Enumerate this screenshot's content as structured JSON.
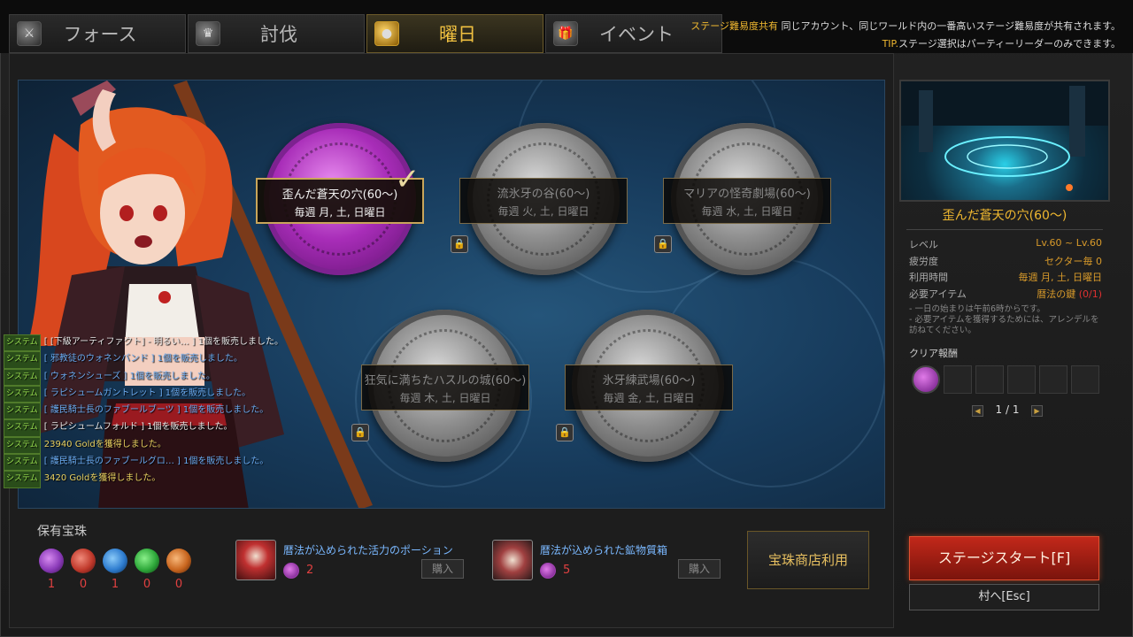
{
  "tabs": [
    {
      "label": "フォース",
      "icon": "force-icon"
    },
    {
      "label": "討伐",
      "icon": "subjugation-icon"
    },
    {
      "label": "曜日",
      "icon": "day-icon",
      "active": true
    },
    {
      "label": "イベント",
      "icon": "event-icon"
    }
  ],
  "notice": {
    "highlight": "ステージ難易度共有",
    "text1": "同じアカウント、同じワールド内の一番高いステージ難易度が共有されます。",
    "tip_highlight": "TIP.",
    "tip": "ステージ選択はパーティーリーダーのみできます。"
  },
  "dungeons": [
    {
      "name": "歪んだ蒼天の穴(60〜)",
      "days": "毎週 月, 土, 日曜日",
      "state": "selected"
    },
    {
      "name": "流氷牙の谷(60〜)",
      "days": "毎週 火, 土, 日曜日",
      "state": "locked"
    },
    {
      "name": "マリアの怪奇劇場(60〜)",
      "days": "毎週 水, 土, 日曜日",
      "state": "locked"
    },
    {
      "name": "狂気に満ちたハスルの城(60〜)",
      "days": "毎週 木, 土, 日曜日",
      "state": "locked"
    },
    {
      "name": "氷牙練武場(60〜)",
      "days": "毎週 金, 土, 日曜日",
      "state": "locked"
    }
  ],
  "chat": [
    {
      "tag": "システム",
      "text": "[ [下級アーティファクト] - 明るい… ] 1個を販売しました。",
      "color": "#e8e8e8"
    },
    {
      "tag": "システム",
      "text": "[ 邪教徒のウォネンバンド ] 1個を販売しました。",
      "color": "#6aaaf0"
    },
    {
      "tag": "システム",
      "text": "[ ウォネンシューズ ] 1個を販売しました。",
      "color": "#6aaaf0"
    },
    {
      "tag": "システム",
      "text": "[ ラピシュームガントレット ] 1個を販売しました。",
      "color": "#6aaaf0"
    },
    {
      "tag": "システム",
      "text": "[ 護民騎士長のファブールブーツ ] 1個を販売しました。",
      "color": "#6aaaf0"
    },
    {
      "tag": "システム",
      "text": "[ ラピシュームフォルド ] 1個を販売しました。",
      "color": "#e8e8e8"
    },
    {
      "tag": "システム",
      "text": "23940 Goldを獲得しました。",
      "color": "#e8d060"
    },
    {
      "tag": "システム",
      "text": "[ 護民騎士長のファブールグロ… ] 1個を販売しました。",
      "color": "#6aaaf0"
    },
    {
      "tag": "システム",
      "text": "3420 Goldを獲得しました。",
      "color": "#e8d060"
    }
  ],
  "orbs": {
    "title": "保有宝珠",
    "items": [
      {
        "color": "#8a3ab8",
        "count": "1"
      },
      {
        "color": "#c0392b",
        "count": "0"
      },
      {
        "color": "#2e7ccf",
        "count": "1"
      },
      {
        "color": "#2ea83a",
        "count": "0"
      },
      {
        "color": "#c8651e",
        "count": "0"
      }
    ]
  },
  "shop": [
    {
      "name": "暦法が込められた活力のポーション",
      "cost": "2",
      "buy": "購入"
    },
    {
      "name": "暦法が込められた鉱物質箱",
      "cost": "5",
      "buy": "購入"
    }
  ],
  "orb_shop_button": "宝珠商店利用",
  "detail": {
    "title": "歪んだ蒼天の穴(60〜)",
    "rows": [
      {
        "k": "レベル",
        "v": "Lv.60 ~ Lv.60"
      },
      {
        "k": "疲労度",
        "v": "セクター毎 0"
      },
      {
        "k": "利用時間",
        "v": "毎週 月, 土, 日曜日"
      },
      {
        "k": "必要アイテム",
        "v": "暦法の鍵 ",
        "v_red": "(0/1)"
      }
    ],
    "notes": [
      "- 一日の始まりは午前6時からです。",
      "- 必要アイテムを獲得するためには、アレンデルを訪ねてください。"
    ],
    "reward_title": "クリア報酬",
    "pager": "1 / 1"
  },
  "start_button": "ステージスタート[F]",
  "village_button": "村へ[Esc]"
}
